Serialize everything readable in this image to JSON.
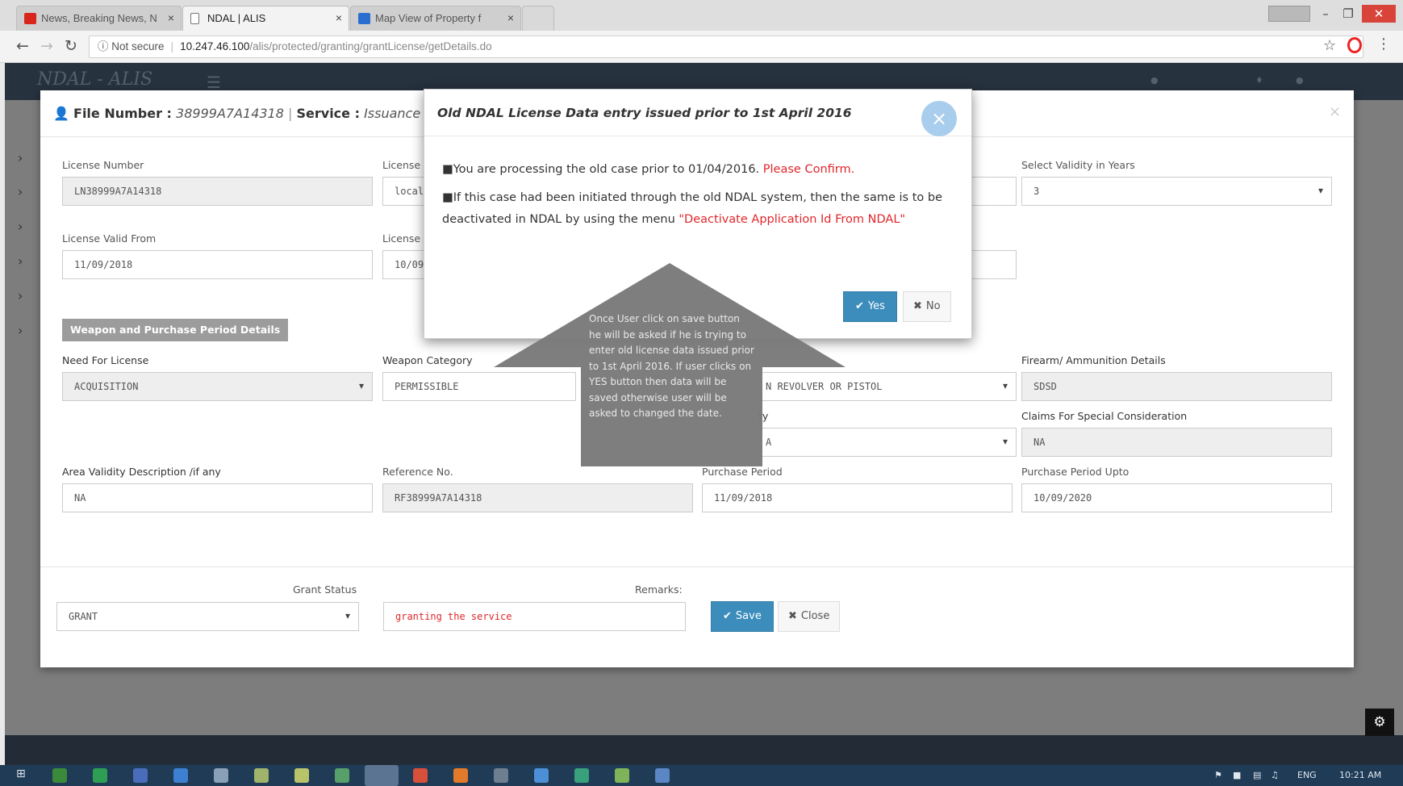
{
  "browser": {
    "tabs": [
      {
        "title": "News, Breaking News, N",
        "favicon_color": "#d9261c",
        "active": false
      },
      {
        "title": "NDAL | ALIS",
        "favicon_color": "#ffffff",
        "active": true
      },
      {
        "title": "Map View of Property f",
        "favicon_color": "#2a6fcf",
        "active": false
      }
    ],
    "tab_close": "×",
    "address": {
      "security": "Not secure",
      "host": "10.247.46.100",
      "path": "/alis/protected/granting/grantLicense/getDetails.do"
    }
  },
  "app": {
    "brand": "NDAL - ALIS"
  },
  "form": {
    "header": {
      "file_label": "File Number :",
      "file_value": "38999A7A14318",
      "divider": "|",
      "service_label": "Service :",
      "service_value": "Issuance Of N"
    },
    "fields": {
      "license_number": {
        "label": "License Number",
        "value": "LN38999A7A14318"
      },
      "license_col2_row1": {
        "label": "License",
        "value": "local/"
      },
      "validity_years": {
        "label": "Select Validity in Years",
        "value": "3"
      },
      "valid_from": {
        "label": "License Valid From",
        "value": "11/09/2018"
      },
      "license_col2_row2": {
        "label": "License",
        "value": "10/09"
      },
      "need_for_license": {
        "label": "Need For License",
        "value": "ACQUISITION"
      },
      "weapon_category": {
        "label": "Weapon Category",
        "value": "PERMISSIBLE"
      },
      "weapon_type": {
        "value": "N REVOLVER OR PISTOL"
      },
      "firearm_details": {
        "label": "Firearm/ Ammunition Details",
        "value": "SDSD"
      },
      "col3_row4": {
        "label_fragment": "ty",
        "value": "A"
      },
      "claims": {
        "label": "Claims For Special Consideration",
        "value": "NA"
      },
      "area_validity": {
        "label": "Area Validity Description /if any",
        "value": "NA"
      },
      "reference_no": {
        "label": "Reference No.",
        "value": "RF38999A7A14318"
      },
      "purchase_period": {
        "label": "Purchase Period",
        "value": "11/09/2018"
      },
      "purchase_upto": {
        "label": "Purchase Period Upto",
        "value": "10/09/2020"
      }
    },
    "section_title": "Weapon and Purchase Period Details",
    "grant_status": {
      "label": "Grant Status",
      "value": "GRANT"
    },
    "remarks": {
      "label": "Remarks:",
      "value": "granting the service"
    },
    "save_label": "Save",
    "close_label": "Close"
  },
  "dialog": {
    "title": "Old NDAL License Data entry issued prior to 1st April 2016",
    "line1_text": "You are processing the old case prior to 01/04/2016. ",
    "line1_highlight": "Please Confirm.",
    "line2_text": "If this case had been initiated through the old NDAL system, then the same is to be deactivated in NDAL by using the menu ",
    "line2_highlight": "\"Deactivate Application Id From NDAL\"",
    "yes_label": "Yes",
    "no_label": "No"
  },
  "annotation": {
    "text": "Once User click on save button he will be asked if he is trying to enter old license data issued prior to 1st April 2016. If user clicks on YES button then data will be saved otherwise user will be asked to changed the date."
  },
  "taskbar": {
    "lang": "ENG",
    "time": "10:21 AM"
  },
  "colors": {
    "primary_button": "#3c8dbc",
    "highlight_red": "#e0262a",
    "callout_gray": "#7a7a7a"
  }
}
